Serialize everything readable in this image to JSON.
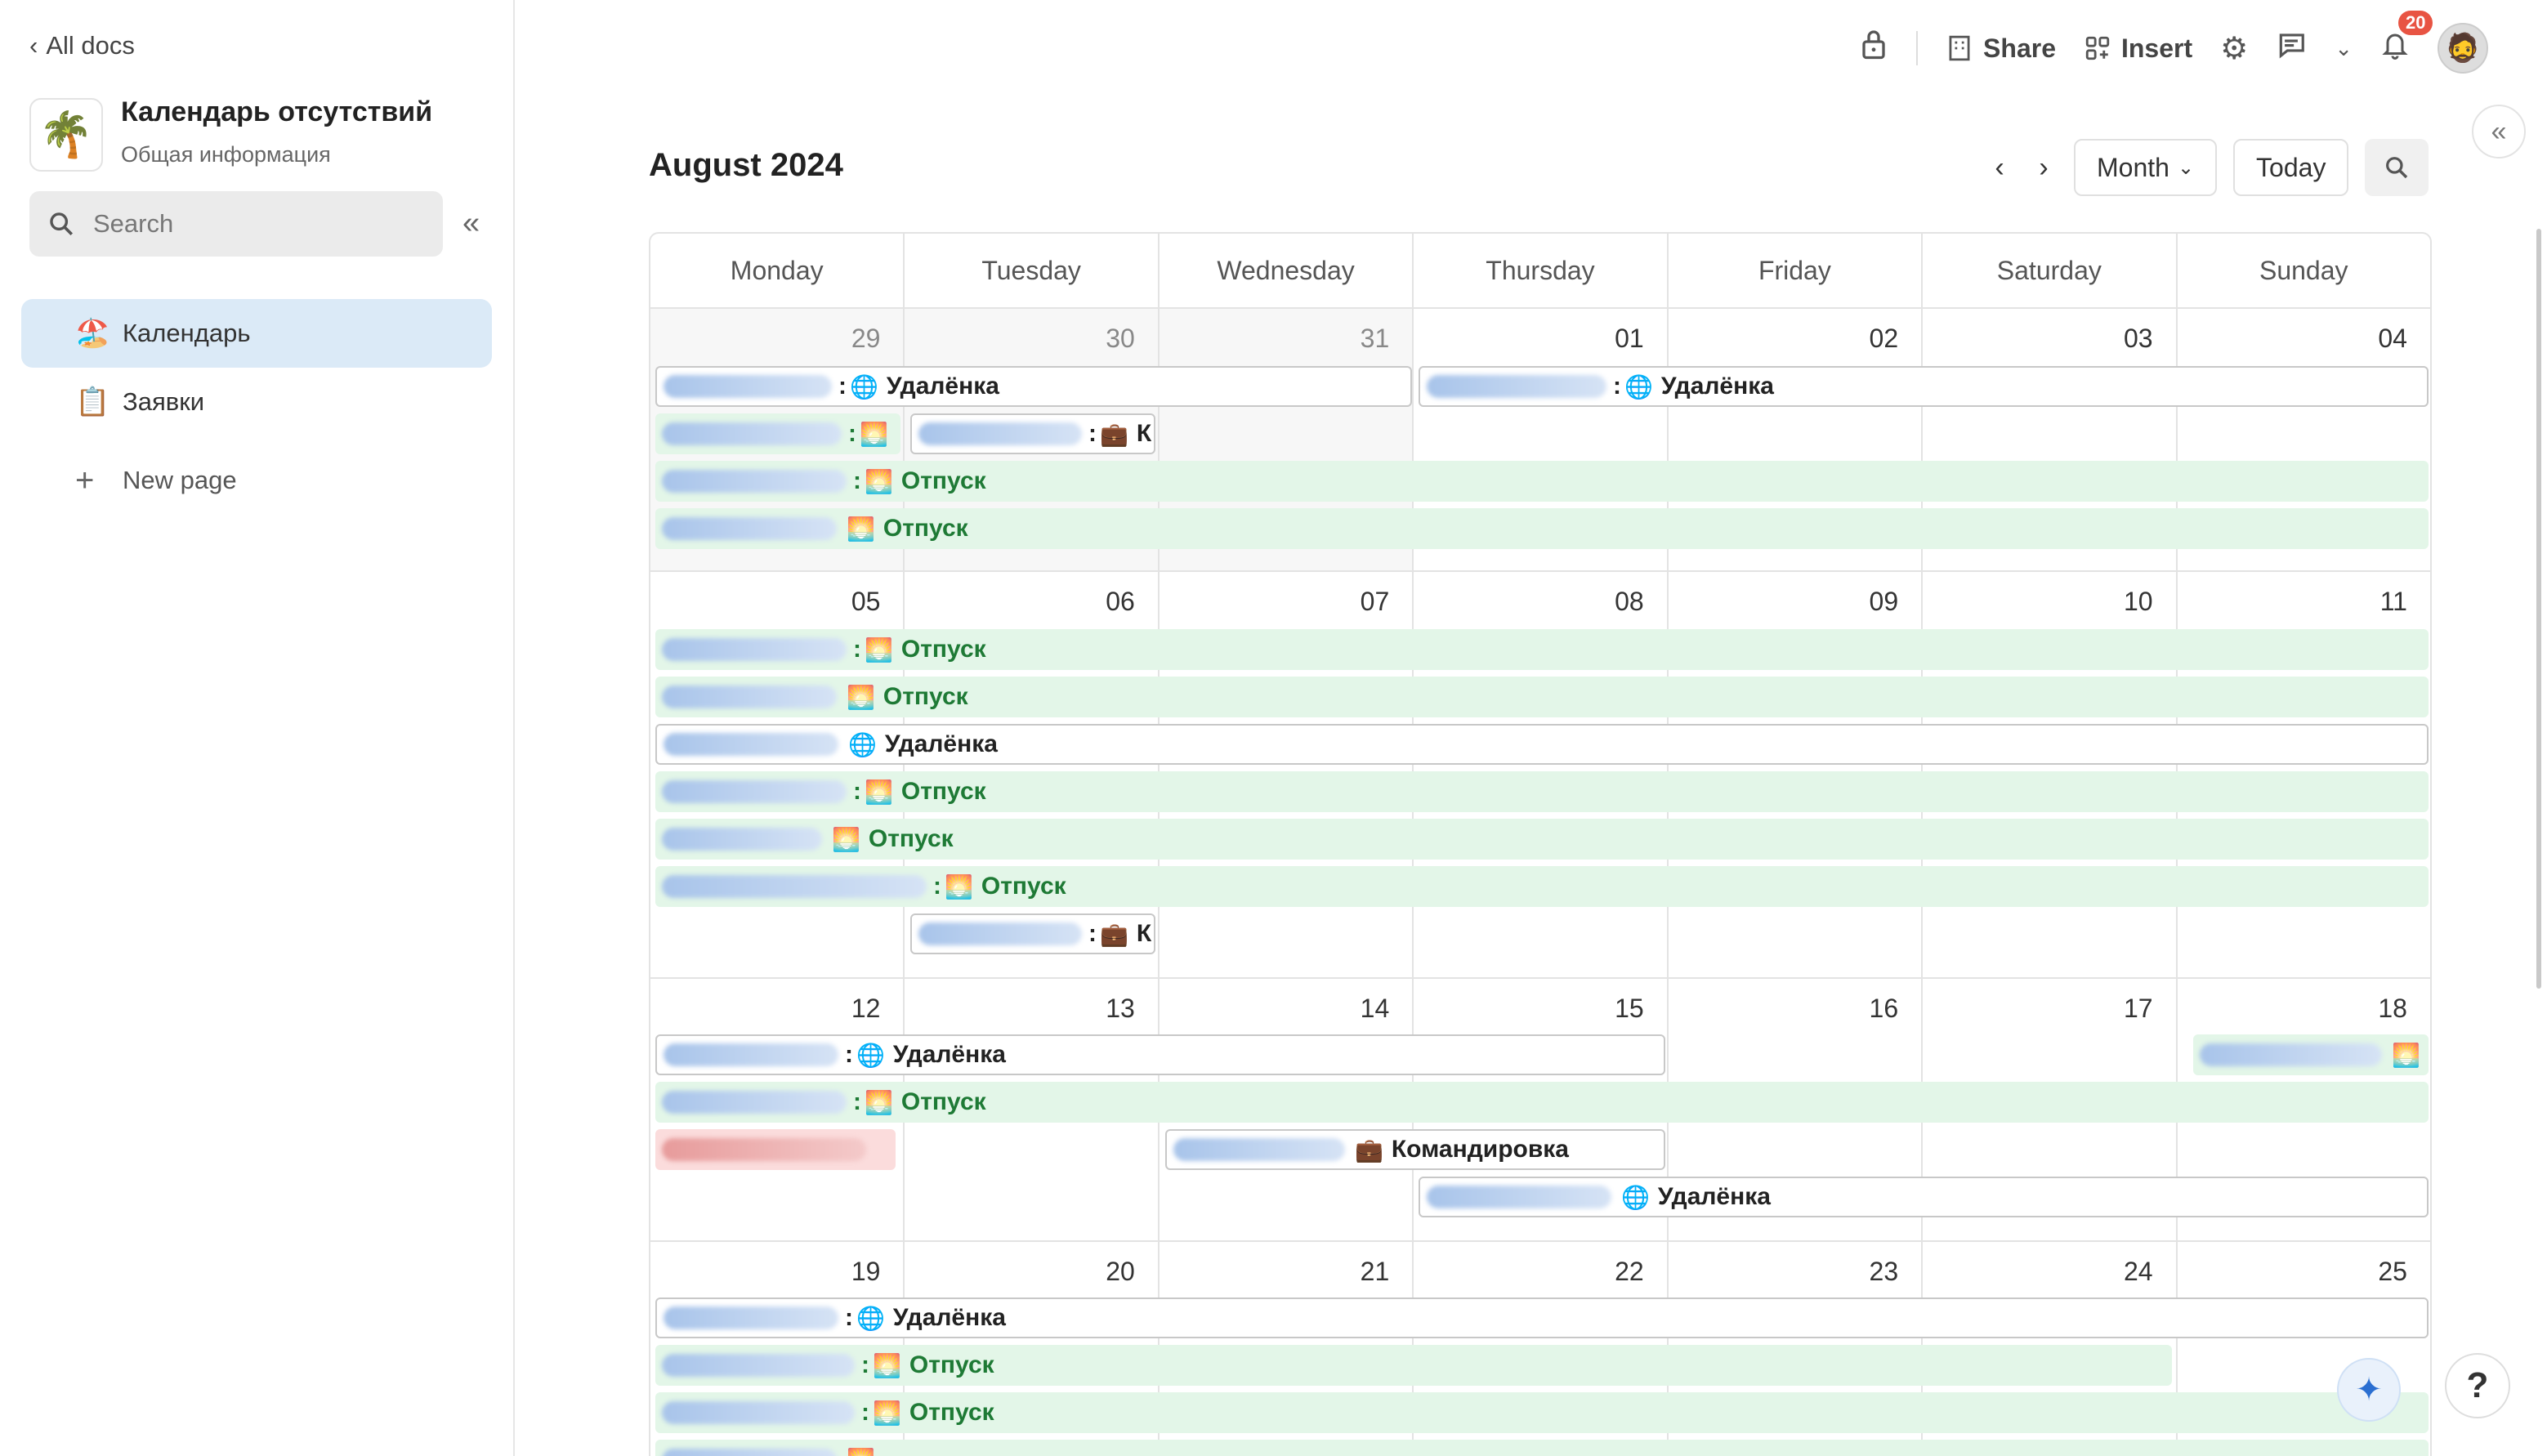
{
  "sidebar": {
    "back_label": "All docs",
    "doc_icon": "palm-tree-icon",
    "doc_title": "Календарь отсутствий",
    "doc_subtitle": "Общая информация",
    "search_placeholder": "Search",
    "items": [
      {
        "label": "Календарь",
        "icon": "🏖️",
        "active": true
      },
      {
        "label": "Заявки",
        "icon": "📋",
        "active": false
      }
    ],
    "new_page_label": "New page"
  },
  "topbar": {
    "share_label": "Share",
    "insert_label": "Insert",
    "notifications_count": "20"
  },
  "calendar": {
    "title": "August 2024",
    "view_label": "Month",
    "today_label": "Today",
    "weekdays": [
      "Monday",
      "Tuesday",
      "Wednesday",
      "Thursday",
      "Friday",
      "Saturday",
      "Sunday"
    ],
    "weeks": [
      {
        "days": [
          "29",
          "30",
          "31",
          "01",
          "02",
          "03",
          "04"
        ],
        "other_month": [
          true,
          true,
          true,
          false,
          false,
          false,
          false
        ]
      },
      {
        "days": [
          "05",
          "06",
          "07",
          "08",
          "09",
          "10",
          "11"
        ],
        "other_month": [
          false,
          false,
          false,
          false,
          false,
          false,
          false
        ]
      },
      {
        "days": [
          "12",
          "13",
          "14",
          "15",
          "16",
          "17",
          "18"
        ],
        "other_month": [
          false,
          false,
          false,
          false,
          false,
          false,
          false
        ]
      },
      {
        "days": [
          "19",
          "20",
          "21",
          "22",
          "23",
          "24",
          "25"
        ],
        "other_month": [
          false,
          false,
          false,
          false,
          false,
          false,
          false
        ]
      }
    ],
    "event_labels": {
      "remote": "Удалёнка",
      "vacation": "Отпуск",
      "trip": "Командировка",
      "trip_short": "К"
    }
  },
  "colors": {
    "accent": "#dbeaf7",
    "vacation_bg": "#e3f6e8",
    "vacation_text": "#1e7a35",
    "badge": "#e85443"
  }
}
